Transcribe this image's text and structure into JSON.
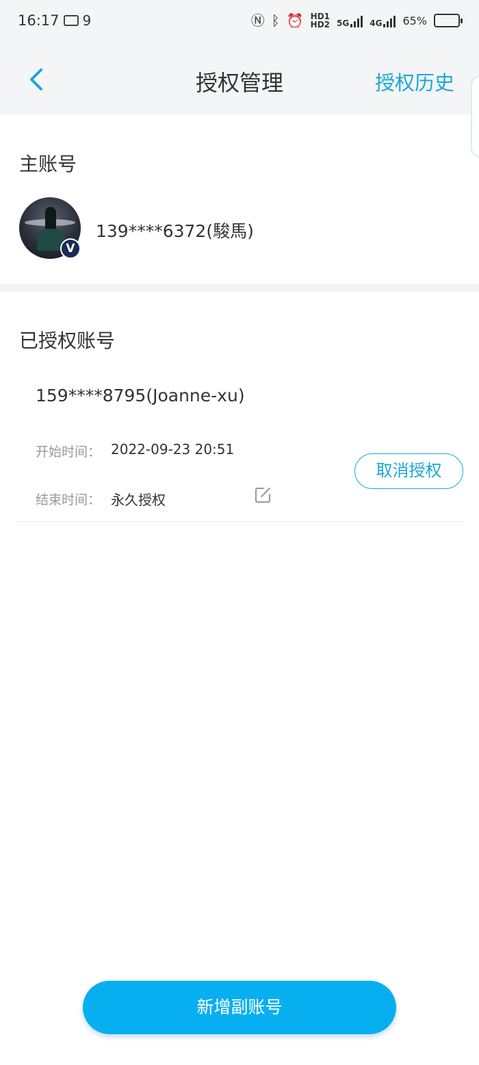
{
  "status_bar": {
    "time": "16:17",
    "notification_count": "9",
    "network_5g": "5G",
    "network_4g": "4G",
    "hd1": "HD1",
    "hd2": "HD2",
    "battery_percent": "65%",
    "battery_level": 0.65
  },
  "nav": {
    "title": "授权管理",
    "history_label": "授权历史"
  },
  "main_section": {
    "title": "主账号",
    "account": "139****6372(駿馬)",
    "badge": "V"
  },
  "authorized_section": {
    "title": "已授权账号",
    "items": [
      {
        "account": "159****8795(Joanne-xu)",
        "start_label": "开始时间：",
        "start_value": "2022-09-23 20:51",
        "end_label": "结束时间：",
        "end_value": "永久授权",
        "cancel_label": "取消授权"
      }
    ]
  },
  "add_button_label": "新增副账号",
  "colors": {
    "accent": "#1ba7d8",
    "primary_button": "#08aff0"
  }
}
